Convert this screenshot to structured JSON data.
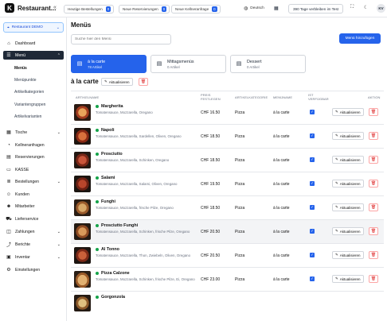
{
  "app": {
    "logo_letter": "K",
    "name": "Restaurant..."
  },
  "topbar": {
    "pills": [
      {
        "label": "Heutige Bestellungen",
        "count": "0"
      },
      {
        "label": "Neue Reservierungen",
        "count": "0"
      },
      {
        "label": "Neue Kellneranfrage",
        "count": "0"
      }
    ],
    "language": "Deutsch",
    "trial": "390 Tage verbleiben im Test",
    "avatar": "KV"
  },
  "sidebar": {
    "restaurant": "Restaurant DEMO",
    "items": [
      {
        "label": "Dashboard",
        "icon": "⌂"
      },
      {
        "label": "Menü",
        "icon": "☰"
      },
      {
        "label": "Tische",
        "icon": "▦"
      },
      {
        "label": "Kellneranfragen",
        "icon": "◔"
      },
      {
        "label": "Reservierungen",
        "icon": "▤"
      },
      {
        "label": "KASSE",
        "icon": "▭"
      },
      {
        "label": "Bestellungen",
        "icon": "≣"
      },
      {
        "label": "Kunden",
        "icon": "☺"
      },
      {
        "label": "Mitarbeiter",
        "icon": "☻"
      },
      {
        "label": "Lieferservice",
        "icon": "⛟"
      },
      {
        "label": "Zahlungen",
        "icon": "◫"
      },
      {
        "label": "Berichte",
        "icon": "⤴"
      },
      {
        "label": "Inventar",
        "icon": "▣"
      },
      {
        "label": "Einstellungen",
        "icon": "⚙"
      }
    ],
    "sub_items": [
      "Menüs",
      "Menüpunkte",
      "Artikelkategorien",
      "Variantengruppen",
      "Artikelvarianten"
    ]
  },
  "main": {
    "title": "Menüs",
    "search_placeholder": "Suche hier den Menü",
    "add_button": "Menü hinzufügen",
    "categories": [
      {
        "title": "à la carte",
        "subtitle": "78 Artikel"
      },
      {
        "title": "Mittagsmenüs",
        "subtitle": "0 Artikel"
      },
      {
        "title": "Dessert",
        "subtitle": "0 Artikel"
      }
    ],
    "section_title": "à la carte",
    "update_label": "Aktualisieren",
    "columns": {
      "name": "Artikelname",
      "price": "Preis festlegen",
      "category": "Artikelkategorie",
      "menu": "Menüname",
      "available": "Ist verfügbar",
      "action": "Aktion"
    }
  },
  "rows": [
    {
      "name": "Margherita",
      "desc": "Tomatensauce, Mozzarella, Oregano",
      "price": "CHF 16.50",
      "category": "Pizza",
      "menu": "à la carte"
    },
    {
      "name": "Napoli",
      "desc": "Tomatensauce, Mozzarella, Sardellen, Oliven, Oregano",
      "price": "CHF 18.50",
      "category": "Pizza",
      "menu": "à la carte"
    },
    {
      "name": "Prosciutto",
      "desc": "Tomatensauce, Mozzarella, Schinken, Oregano",
      "price": "CHF 18.50",
      "category": "Pizza",
      "menu": "à la carte"
    },
    {
      "name": "Salami",
      "desc": "Tomatensauce, Mozzarella, Salami, Oliven, Oregano",
      "price": "CHF 19.50",
      "category": "Pizza",
      "menu": "à la carte"
    },
    {
      "name": "Funghi",
      "desc": "Tomatensauce, Mozzarella, frische Pilze, Oregano",
      "price": "CHF 18.50",
      "category": "Pizza",
      "menu": "à la carte"
    },
    {
      "name": "Prosciutto Funghi",
      "desc": "Tomatensauce, Mozzarella, Schinken, frische Pilze, Oregano",
      "price": "CHF 20.50",
      "category": "Pizza",
      "menu": "à la carte"
    },
    {
      "name": "Al Tonno",
      "desc": "Tomatensauce, Mozzarella, Thon, Zwiebeln, Oliven, Oregano",
      "price": "CHF 20.50",
      "category": "Pizza",
      "menu": "à la carte"
    },
    {
      "name": "Pizza Calzone",
      "desc": "Tomatensauce, Mozzarella, Schinken, frische Pilze, Ei, Oregano",
      "price": "CHF 23.00",
      "category": "Pizza",
      "menu": "à la carte"
    },
    {
      "name": "Gorgonzola",
      "desc": "",
      "price": "",
      "category": "",
      "menu": ""
    }
  ]
}
